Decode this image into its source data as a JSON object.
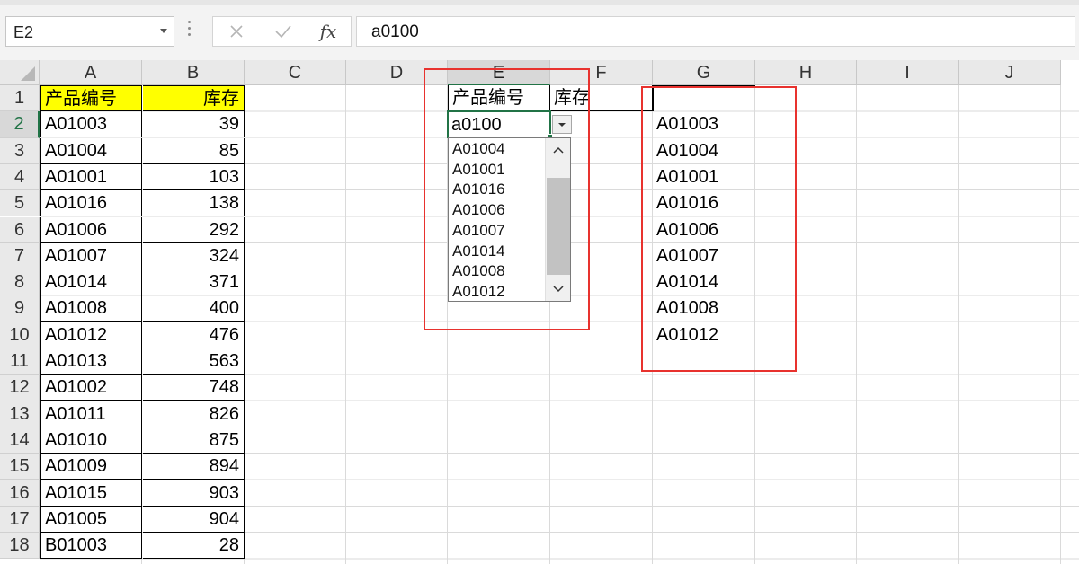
{
  "name_box": {
    "value": "E2"
  },
  "formula_bar": {
    "cancel_icon": "close-icon",
    "enter_icon": "check-icon",
    "fx_label": "fx",
    "value": "a0100"
  },
  "columns": [
    "A",
    "B",
    "C",
    "D",
    "E",
    "F",
    "G",
    "H",
    "I",
    "J"
  ],
  "selected_column": "E",
  "rows": [
    "1",
    "2",
    "3",
    "4",
    "5",
    "6",
    "7",
    "8",
    "9",
    "10",
    "11",
    "12",
    "13",
    "14",
    "15",
    "16",
    "17",
    "18"
  ],
  "selected_row": "2",
  "source_table": {
    "headers": [
      "产品编号",
      "库存"
    ],
    "header_fill": "#ffff00",
    "records": [
      {
        "code": "A01003",
        "stock": "39"
      },
      {
        "code": "A01004",
        "stock": "85"
      },
      {
        "code": "A01001",
        "stock": "103"
      },
      {
        "code": "A01016",
        "stock": "138"
      },
      {
        "code": "A01006",
        "stock": "292"
      },
      {
        "code": "A01007",
        "stock": "324"
      },
      {
        "code": "A01014",
        "stock": "371"
      },
      {
        "code": "A01008",
        "stock": "400"
      },
      {
        "code": "A01012",
        "stock": "476"
      },
      {
        "code": "A01013",
        "stock": "563"
      },
      {
        "code": "A01002",
        "stock": "748"
      },
      {
        "code": "A01011",
        "stock": "826"
      },
      {
        "code": "A01010",
        "stock": "875"
      },
      {
        "code": "A01009",
        "stock": "894"
      },
      {
        "code": "A01015",
        "stock": "903"
      },
      {
        "code": "A01005",
        "stock": "904"
      },
      {
        "code": "B01003",
        "stock": "28"
      }
    ]
  },
  "lookup": {
    "header_code": "产品编号",
    "header_stock": "库存",
    "input_value": "a0100",
    "dropdown_items": [
      "A01004",
      "A01001",
      "A01016",
      "A01006",
      "A01007",
      "A01014",
      "A01008",
      "A01012"
    ]
  },
  "helper_column": {
    "values": [
      "A01003",
      "A01004",
      "A01001",
      "A01016",
      "A01006",
      "A01007",
      "A01014",
      "A01008",
      "A01012"
    ]
  },
  "colors": {
    "accent": "#217346",
    "highlight_box": "#e8322e",
    "header_fill": "#ffff00"
  }
}
